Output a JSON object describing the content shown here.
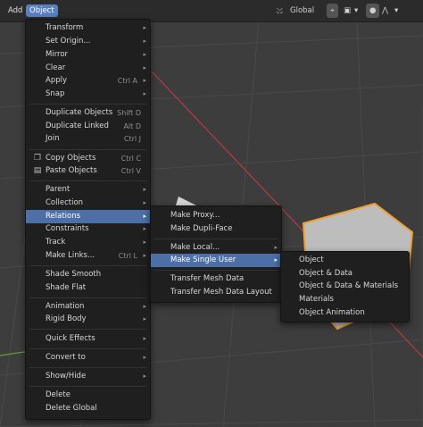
{
  "header": {
    "add_label": "Add",
    "object_label": "Object",
    "transform_orientation": "Global"
  },
  "object_menu": {
    "items": [
      {
        "label": "Transform",
        "submenu": true
      },
      {
        "label": "Set Origin...",
        "submenu": true
      },
      {
        "label": "Mirror",
        "submenu": true
      },
      {
        "label": "Clear",
        "submenu": true
      },
      {
        "label": "Apply",
        "shortcut": "Ctrl A",
        "submenu": true
      },
      {
        "label": "Snap",
        "submenu": true
      },
      {
        "label": "Duplicate Objects",
        "shortcut": "Shift D"
      },
      {
        "label": "Duplicate Linked",
        "shortcut": "Alt D"
      },
      {
        "label": "Join",
        "shortcut": "Ctrl J"
      },
      {
        "label": "Copy Objects",
        "shortcut": "Ctrl C",
        "icon": "copy-icon"
      },
      {
        "label": "Paste Objects",
        "shortcut": "Ctrl V",
        "icon": "paste-icon"
      },
      {
        "label": "Parent",
        "submenu": true
      },
      {
        "label": "Collection",
        "submenu": true
      },
      {
        "label": "Relations",
        "submenu": true,
        "highlighted": true
      },
      {
        "label": "Constraints",
        "submenu": true
      },
      {
        "label": "Track",
        "submenu": true
      },
      {
        "label": "Make Links...",
        "shortcut": "Ctrl L",
        "submenu": true
      },
      {
        "label": "Shade Smooth"
      },
      {
        "label": "Shade Flat"
      },
      {
        "label": "Animation",
        "submenu": true
      },
      {
        "label": "Rigid Body",
        "submenu": true
      },
      {
        "label": "Quick Effects",
        "submenu": true
      },
      {
        "label": "Convert to",
        "submenu": true
      },
      {
        "label": "Show/Hide",
        "submenu": true
      },
      {
        "label": "Delete"
      },
      {
        "label": "Delete Global"
      }
    ]
  },
  "relations_menu": {
    "items": [
      {
        "label": "Make Proxy..."
      },
      {
        "label": "Make Dupli-Face"
      },
      {
        "label": "Make Local...",
        "submenu": true
      },
      {
        "label": "Make Single User",
        "submenu": true,
        "highlighted": true
      },
      {
        "label": "Transfer Mesh Data"
      },
      {
        "label": "Transfer Mesh Data Layout"
      }
    ]
  },
  "single_user_menu": {
    "items": [
      {
        "label": "Object"
      },
      {
        "label": "Object & Data"
      },
      {
        "label": "Object & Data & Materials"
      },
      {
        "label": "Materials"
      },
      {
        "label": "Object Animation"
      }
    ]
  },
  "colors": {
    "highlight": "#4c6fa8",
    "header_active": "#5680c2",
    "selection_outline": "#f0a030",
    "x_axis": "#c0384a"
  }
}
